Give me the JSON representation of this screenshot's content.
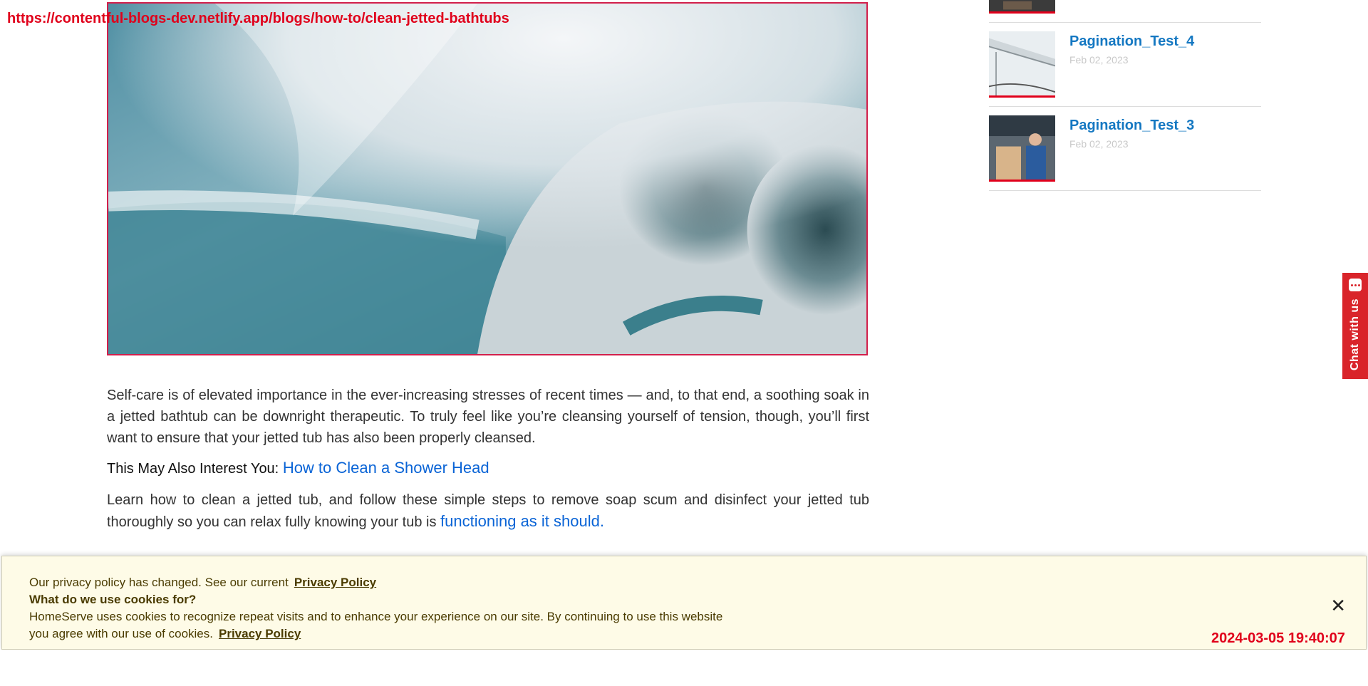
{
  "overlay": {
    "url": "https://contentful-blogs-dev.netlify.app/blogs/how-to/clean-jetted-bathtubs",
    "timestamp": "2024-03-05 19:40:07"
  },
  "article": {
    "paragraph1": "Self-care is of elevated importance in the ever-increasing stresses of recent times — and, to that end, a soothing soak in a jetted bathtub can be downright therapeutic. To truly feel like you’re cleansing yourself of tension, though, you’ll first want to ensure that your jetted tub has also been properly cleansed.",
    "interest_label": "This May Also Interest You:",
    "interest_link": "How to Clean a Shower Head",
    "paragraph2_text": "Learn how to clean a jetted tub, and follow these simple steps to remove soap scum and disinfect your jetted tub thoroughly so you can relax fully knowing your tub is",
    "paragraph2_link": "functioning as it should."
  },
  "sidebar": {
    "items": [
      {
        "title": "Pagination_Test_4",
        "date": "Feb 02, 2023"
      },
      {
        "title": "Pagination_Test_3",
        "date": "Feb 02, 2023"
      }
    ]
  },
  "chat": {
    "label": "Chat with us"
  },
  "cookie": {
    "line1": "Our privacy policy has changed. See our current",
    "link1": "Privacy Policy",
    "heading": "What do we use cookies for?",
    "line3": "HomeServe uses cookies to recognize repeat visits and to enhance your experience on our site. By continuing to use this website you agree with our use of cookies.",
    "link2": "Privacy Policy",
    "close_symbol": "✕"
  },
  "colors": {
    "accent_red": "#e0001b",
    "link_blue": "#0a64d6",
    "sidebar_title_blue": "#1578c2",
    "cookie_bg": "#fefbe7"
  }
}
